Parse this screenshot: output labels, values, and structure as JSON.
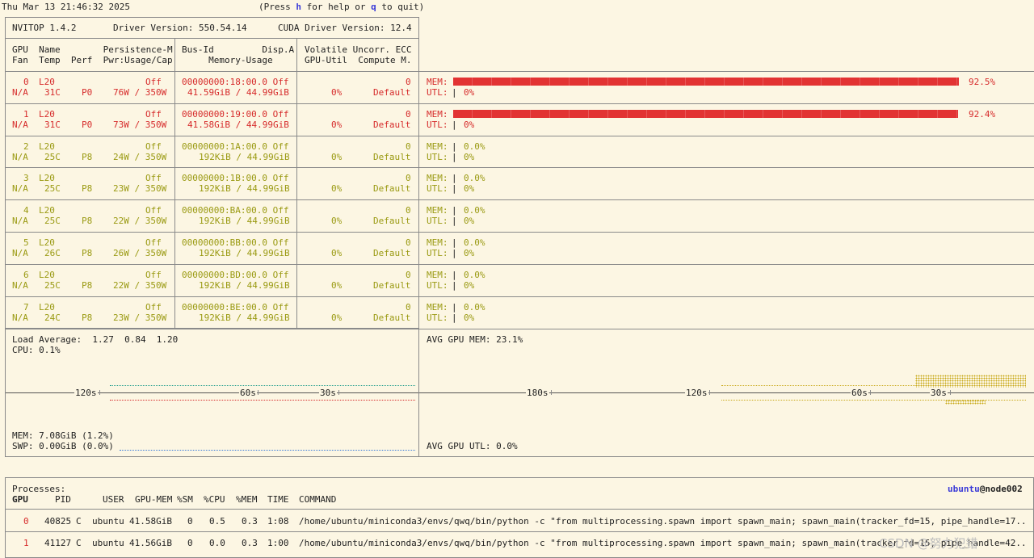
{
  "topbar": {
    "datetime": "Thu Mar 13 21:46:32 2025",
    "help_prefix": "(Press ",
    "help_key": "h",
    "help_mid": " for help or ",
    "quit_key": "q",
    "help_suffix": " to quit)"
  },
  "header": {
    "nvitop": "NVITOP 1.4.2",
    "driver": "Driver Version: 550.54.14",
    "cuda": "CUDA Driver Version: 12.4",
    "col1_line1": "GPU  Name        Persistence-M",
    "col1_line2": "Fan  Temp  Perf  Pwr:Usage/Cap",
    "col2_line1": "Bus-Id         Disp.A",
    "col2_line2": "     Memory-Usage",
    "col3_line1": "Volatile Uncorr. ECC",
    "col3_line2": "GPU-Util  Compute M."
  },
  "gpus": [
    {
      "idx": "0",
      "name": "L20",
      "persist": "Off",
      "fan": "N/A",
      "temp": "31C",
      "perf": "P0",
      "power": "76W / 350W",
      "bus": "00000000:18:00.0 Off",
      "mem": "41.59GiB / 44.99GiB",
      "ecc": "0",
      "util": "0%",
      "compute": "Default",
      "mem_label": "MEM:",
      "utl_label": "UTL:",
      "mem_pct": "92.5%",
      "utl_pct": "0%",
      "mem_fraction": 0.925,
      "active": true
    },
    {
      "idx": "1",
      "name": "L20",
      "persist": "Off",
      "fan": "N/A",
      "temp": "31C",
      "perf": "P0",
      "power": "73W / 350W",
      "bus": "00000000:19:00.0 Off",
      "mem": "41.58GiB / 44.99GiB",
      "ecc": "0",
      "util": "0%",
      "compute": "Default",
      "mem_label": "MEM:",
      "utl_label": "UTL:",
      "mem_pct": "92.4%",
      "utl_pct": "0%",
      "mem_fraction": 0.924,
      "active": true
    },
    {
      "idx": "2",
      "name": "L20",
      "persist": "Off",
      "fan": "N/A",
      "temp": "25C",
      "perf": "P8",
      "power": "24W / 350W",
      "bus": "00000000:1A:00.0 Off",
      "mem": "192KiB / 44.99GiB",
      "ecc": "0",
      "util": "0%",
      "compute": "Default",
      "mem_label": "MEM:",
      "utl_label": "UTL:",
      "mem_pct": "0.0%",
      "utl_pct": "0%",
      "mem_fraction": 0,
      "active": false
    },
    {
      "idx": "3",
      "name": "L20",
      "persist": "Off",
      "fan": "N/A",
      "temp": "25C",
      "perf": "P8",
      "power": "23W / 350W",
      "bus": "00000000:1B:00.0 Off",
      "mem": "192KiB / 44.99GiB",
      "ecc": "0",
      "util": "0%",
      "compute": "Default",
      "mem_label": "MEM:",
      "utl_label": "UTL:",
      "mem_pct": "0.0%",
      "utl_pct": "0%",
      "mem_fraction": 0,
      "active": false
    },
    {
      "idx": "4",
      "name": "L20",
      "persist": "Off",
      "fan": "N/A",
      "temp": "25C",
      "perf": "P8",
      "power": "22W / 350W",
      "bus": "00000000:BA:00.0 Off",
      "mem": "192KiB / 44.99GiB",
      "ecc": "0",
      "util": "0%",
      "compute": "Default",
      "mem_label": "MEM:",
      "utl_label": "UTL:",
      "mem_pct": "0.0%",
      "utl_pct": "0%",
      "mem_fraction": 0,
      "active": false
    },
    {
      "idx": "5",
      "name": "L20",
      "persist": "Off",
      "fan": "N/A",
      "temp": "26C",
      "perf": "P8",
      "power": "26W / 350W",
      "bus": "00000000:BB:00.0 Off",
      "mem": "192KiB / 44.99GiB",
      "ecc": "0",
      "util": "0%",
      "compute": "Default",
      "mem_label": "MEM:",
      "utl_label": "UTL:",
      "mem_pct": "0.0%",
      "utl_pct": "0%",
      "mem_fraction": 0,
      "active": false
    },
    {
      "idx": "6",
      "name": "L20",
      "persist": "Off",
      "fan": "N/A",
      "temp": "25C",
      "perf": "P8",
      "power": "22W / 350W",
      "bus": "00000000:BD:00.0 Off",
      "mem": "192KiB / 44.99GiB",
      "ecc": "0",
      "util": "0%",
      "compute": "Default",
      "mem_label": "MEM:",
      "utl_label": "UTL:",
      "mem_pct": "0.0%",
      "utl_pct": "0%",
      "mem_fraction": 0,
      "active": false
    },
    {
      "idx": "7",
      "name": "L20",
      "persist": "Off",
      "fan": "N/A",
      "temp": "24C",
      "perf": "P8",
      "power": "23W / 350W",
      "bus": "00000000:BE:00.0 Off",
      "mem": "192KiB / 44.99GiB",
      "ecc": "0",
      "util": "0%",
      "compute": "Default",
      "mem_label": "MEM:",
      "utl_label": "UTL:",
      "mem_pct": "0.0%",
      "utl_pct": "0%",
      "mem_fraction": 0,
      "active": false
    }
  ],
  "host": {
    "load": "Load Average:  1.27  0.84  1.20",
    "cpu": "CPU: 0.1%",
    "mem": "MEM: 7.08GiB (1.2%)",
    "swp": "SWP: 0.00GiB (0.0%)",
    "t120": "120s",
    "t60": "60s",
    "t30": "30s"
  },
  "gpu_avg": {
    "mem": "AVG GPU MEM: 23.1%",
    "utl": "AVG GPU UTL: 0.0%",
    "t180": "180s",
    "t120": "120s",
    "t60": "60s",
    "t30": "30s"
  },
  "processes": {
    "title": "Processes:",
    "user": "ubuntu",
    "host": "@node002",
    "headers": [
      "GPU",
      "PID",
      "USER",
      "GPU-MEM",
      "%SM",
      "%CPU",
      "%MEM",
      "TIME",
      "COMMAND"
    ],
    "rows": [
      {
        "gpu": "0",
        "pid": "40825",
        "type": "C",
        "user": "ubuntu",
        "gpumem": "41.58GiB",
        "sm": "0",
        "cpu": "0.5",
        "mem": "0.3",
        "time": "1:08",
        "command": "/home/ubuntu/miniconda3/envs/qwq/bin/python -c \"from multiprocessing.spawn import spawn_main; spawn_main(tracker_fd=15, pipe_handle=17.."
      },
      {
        "gpu": "1",
        "pid": "41127",
        "type": "C",
        "user": "ubuntu",
        "gpumem": "41.56GiB",
        "sm": "0",
        "cpu": "0.0",
        "mem": "0.3",
        "time": "1:00",
        "command": "/home/ubuntu/miniconda3/envs/qwq/bin/python -c \"from multiprocessing.spawn import spawn_main; spawn_main(tracker_fd=15, pipe_handle=42.."
      }
    ]
  },
  "watermark": "CSDN @努力犯错"
}
